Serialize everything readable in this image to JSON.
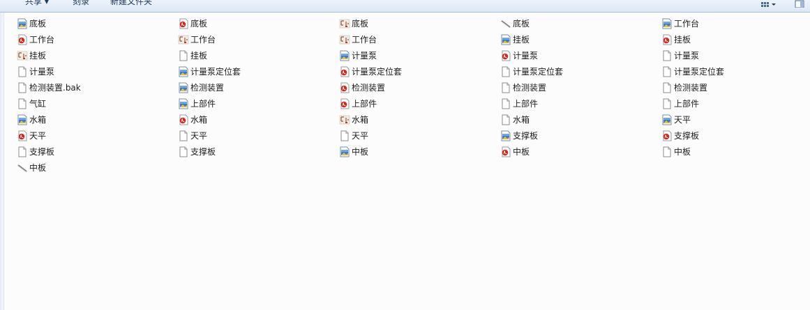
{
  "toolbar": {
    "share_label": "共享 ▾",
    "burn_label": "刻录",
    "new_folder_label": "新建文件夹"
  },
  "files": [
    {
      "name": "底板",
      "icon": "image-icon"
    },
    {
      "name": "底板",
      "icon": "pdf-icon"
    },
    {
      "name": "底板",
      "icon": "drawing-thumb-icon"
    },
    {
      "name": "底板",
      "icon": "line-thumb-icon"
    },
    {
      "name": "工作台",
      "icon": "image-icon"
    },
    {
      "name": "工作台",
      "icon": "pdf-icon"
    },
    {
      "name": "工作台",
      "icon": "drawing-thumb-icon"
    },
    {
      "name": "工作台",
      "icon": "drawing-thumb-icon"
    },
    {
      "name": "挂板",
      "icon": "image-icon"
    },
    {
      "name": "挂板",
      "icon": "pdf-icon"
    },
    {
      "name": "挂板",
      "icon": "drawing-thumb-icon"
    },
    {
      "name": "挂板",
      "icon": "blank-file-icon"
    },
    {
      "name": "计量泵",
      "icon": "image-icon"
    },
    {
      "name": "计量泵",
      "icon": "pdf-icon"
    },
    {
      "name": "计量泵",
      "icon": "blank-file-icon"
    },
    {
      "name": "计量泵",
      "icon": "blank-file-icon"
    },
    {
      "name": "计量泵定位套",
      "icon": "image-icon"
    },
    {
      "name": "计量泵定位套",
      "icon": "pdf-icon"
    },
    {
      "name": "计量泵定位套",
      "icon": "blank-file-icon"
    },
    {
      "name": "计量泵定位套",
      "icon": "blank-file-icon"
    },
    {
      "name": "检测装置.bak",
      "icon": "blank-file-icon"
    },
    {
      "name": "检测装置",
      "icon": "image-icon"
    },
    {
      "name": "检测装置",
      "icon": "pdf-icon"
    },
    {
      "name": "检测装置",
      "icon": "blank-file-icon"
    },
    {
      "name": "检测装置",
      "icon": "blank-file-icon"
    },
    {
      "name": "气缸",
      "icon": "blank-file-icon"
    },
    {
      "name": "上部件",
      "icon": "image-icon"
    },
    {
      "name": "上部件",
      "icon": "pdf-icon"
    },
    {
      "name": "上部件",
      "icon": "blank-file-icon"
    },
    {
      "name": "上部件",
      "icon": "blank-file-icon"
    },
    {
      "name": "水箱",
      "icon": "image-icon"
    },
    {
      "name": "水箱",
      "icon": "pdf-icon"
    },
    {
      "name": "水箱",
      "icon": "drawing-thumb-icon"
    },
    {
      "name": "水箱",
      "icon": "blank-file-icon"
    },
    {
      "name": "天平",
      "icon": "image-icon"
    },
    {
      "name": "天平",
      "icon": "pdf-icon"
    },
    {
      "name": "天平",
      "icon": "blank-file-icon"
    },
    {
      "name": "天平",
      "icon": "blank-file-icon"
    },
    {
      "name": "支撑板",
      "icon": "image-icon"
    },
    {
      "name": "支撑板",
      "icon": "pdf-icon"
    },
    {
      "name": "支撑板",
      "icon": "blank-file-icon"
    },
    {
      "name": "支撑板",
      "icon": "blank-file-icon"
    },
    {
      "name": "中板",
      "icon": "image-icon"
    },
    {
      "name": "中板",
      "icon": "pdf-icon"
    },
    {
      "name": "中板",
      "icon": "blank-file-icon"
    },
    {
      "name": "中板",
      "icon": "line-thumb-icon"
    }
  ]
}
